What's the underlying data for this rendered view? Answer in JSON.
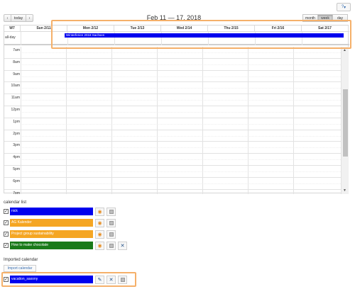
{
  "toolbar": {
    "help_icon": "?",
    "help_caret": "▾",
    "prev": "‹",
    "today": "today",
    "next": "›",
    "title": "Feb 11 — 17, 2018",
    "views": [
      "month",
      "week",
      "day"
    ],
    "active_view": "week"
  },
  "calendar": {
    "week_label": "W7",
    "days": [
      "Sun 2/11",
      "Mon 2/12",
      "Tue 2/13",
      "Wed 2/14",
      "Thu 2/15",
      "Fri 2/16",
      "Sat 2/17"
    ],
    "allday_label": "all-day",
    "event": {
      "title": "Winterferien 2018 Sachsen",
      "color": "#0000ee"
    },
    "times": [
      "7am",
      "8am",
      "9am",
      "10am",
      "11am",
      "12pm",
      "1pm",
      "2pm",
      "3pm",
      "4pm",
      "5pm",
      "6pm",
      "7pm"
    ]
  },
  "calendar_list": {
    "title": "calendar list",
    "items": [
      {
        "name": "nick",
        "color": "#0000ee",
        "checked": "✓",
        "delete": false
      },
      {
        "name": "AG Kalender",
        "color": "#f5a623",
        "checked": "✓",
        "delete": false
      },
      {
        "name": "Project group sustainability",
        "color": "#f5a623",
        "checked": "✓",
        "delete": false
      },
      {
        "name": "How to make chocolate",
        "color": "#1a7a1a",
        "checked": "✓",
        "delete": true
      }
    ]
  },
  "imported": {
    "title": "Imported calendar",
    "import_button": "Import calendar",
    "items": [
      {
        "name": "vacation_saxony",
        "color": "#0000ee",
        "checked": "✓"
      }
    ]
  },
  "icons": {
    "rss": "rss-icon",
    "x": "✕",
    "pen": "✎"
  }
}
